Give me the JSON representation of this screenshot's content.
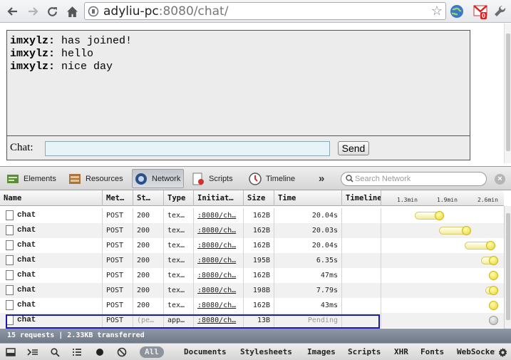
{
  "browser": {
    "url_host": "adyliu-pc",
    "url_rest": ":8080/chat/",
    "gmail_badge": "0"
  },
  "chat": {
    "messages": [
      {
        "user": "imxylz:",
        "text": "has joined!"
      },
      {
        "user": "imxylz:",
        "text": "hello"
      },
      {
        "user": "imxylz:",
        "text": "nice day"
      }
    ],
    "input_label": "Chat:",
    "input_value": "",
    "send_label": "Send"
  },
  "devtools": {
    "tabs": [
      {
        "label": "Elements",
        "icon": "elements-icon"
      },
      {
        "label": "Resources",
        "icon": "resources-icon"
      },
      {
        "label": "Network",
        "icon": "network-icon",
        "active": true
      },
      {
        "label": "Scripts",
        "icon": "scripts-icon"
      },
      {
        "label": "Timeline",
        "icon": "timeline-icon"
      }
    ],
    "more_label": "»",
    "search_placeholder": "Search Network",
    "close_label": "×"
  },
  "network": {
    "columns": [
      "Name",
      "Met…",
      "St…",
      "Type",
      "Initiat…",
      "Size",
      "Time",
      "Timeline"
    ],
    "timeline_ticks": [
      "1.3min",
      "1.9min",
      "2.6min"
    ],
    "rows": [
      {
        "name": "chat",
        "method": "POST",
        "status": "200",
        "type": "tex…",
        "initiator": ":8080/ch…",
        "size": "162B",
        "time": "20.04s",
        "tl_start": 0.02,
        "tl_end": 0.26
      },
      {
        "name": "chat",
        "method": "POST",
        "status": "200",
        "type": "tex…",
        "initiator": ":8080/ch…",
        "size": "162B",
        "time": "20.03s",
        "tl_start": 0.32,
        "tl_end": 0.6
      },
      {
        "name": "chat",
        "method": "POST",
        "status": "200",
        "type": "tex…",
        "initiator": ":8080/ch…",
        "size": "162B",
        "time": "20.04s",
        "tl_start": 0.64,
        "tl_end": 0.9
      },
      {
        "name": "chat",
        "method": "POST",
        "status": "200",
        "type": "tex…",
        "initiator": ":8080/ch…",
        "size": "195B",
        "time": "6.35s",
        "tl_start": 0.85,
        "tl_end": 0.94
      },
      {
        "name": "chat",
        "method": "POST",
        "status": "200",
        "type": "tex…",
        "initiator": ":8080/ch…",
        "size": "162B",
        "time": "47ms",
        "tl_start": 0.93,
        "tl_end": 0.94
      },
      {
        "name": "chat",
        "method": "POST",
        "status": "200",
        "type": "tex…",
        "initiator": ":8080/ch…",
        "size": "198B",
        "time": "7.79s",
        "tl_start": 0.9,
        "tl_end": 0.99
      },
      {
        "name": "chat",
        "method": "POST",
        "status": "200",
        "type": "tex…",
        "initiator": ":8080/ch…",
        "size": "162B",
        "time": "43ms",
        "tl_start": 0.99,
        "tl_end": 0.99
      },
      {
        "name": "chat",
        "method": "POST",
        "status": "(pe…",
        "type": "app…",
        "initiator": ":8080/ch…",
        "size": "13B",
        "time": "Pending",
        "tl_start": 1.0,
        "tl_end": 1.0,
        "pending": true,
        "selected": true
      }
    ],
    "summary": "15 requests  |  2.33KB transferred"
  },
  "statusbar": {
    "filters": [
      "All",
      "Documents",
      "Stylesheets",
      "Images",
      "Scripts",
      "XHR",
      "Fonts",
      "WebSockets"
    ],
    "active_filter": "All"
  },
  "colors": {
    "selection_border": "#1a1ab0",
    "timeline_bar": "#f4ec9c",
    "summary_bg": "#7b8593"
  }
}
